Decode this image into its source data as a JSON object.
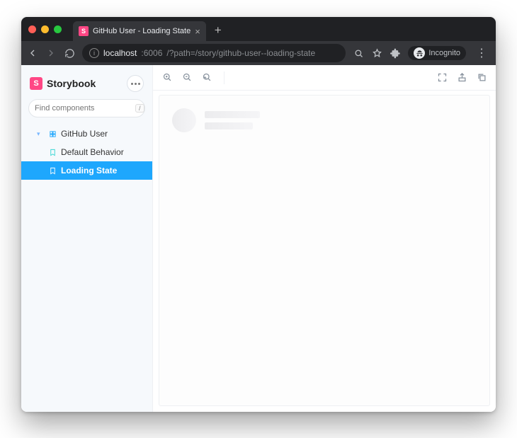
{
  "browser": {
    "tab": {
      "title": "GitHub User - Loading State"
    },
    "url": {
      "host": "localhost",
      "port": ":6006",
      "path": "/?path=/story/github-user--loading-state"
    },
    "incognito_label": "Incognito"
  },
  "sidebar": {
    "brand": "Storybook",
    "search_placeholder": "Find components",
    "search_shortcut": "/",
    "tree": {
      "group": "GitHub User",
      "stories": [
        {
          "label": "Default Behavior",
          "active": false
        },
        {
          "label": "Loading State",
          "active": true
        }
      ]
    }
  }
}
